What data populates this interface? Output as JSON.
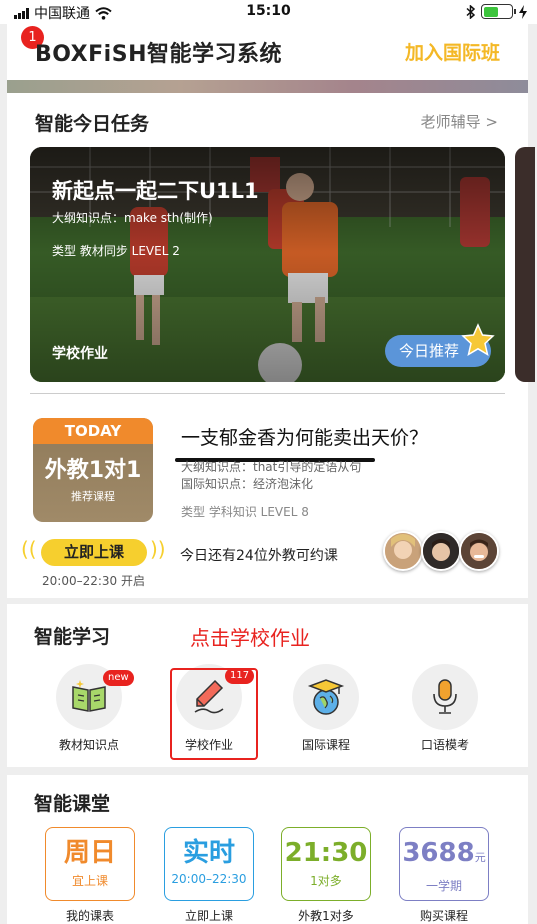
{
  "status_bar": {
    "carrier": "中国联通",
    "time": "15:10"
  },
  "header": {
    "notification_count": "1",
    "title": "BOXFiSH智能学习系统",
    "join_label": "加入国际班"
  },
  "today_task": {
    "title": "智能今日任务",
    "teacher_link": "老师辅导 >",
    "card": {
      "title": "新起点一起二下U1L1",
      "syllabus_point": "大纲知识点：make sth(制作)",
      "type_level": "类型  教材同步   LEVEL 2",
      "tag": "学校作业",
      "recommend": "今日推荐"
    },
    "lesson": {
      "today_label": "TODAY",
      "box_main": "外教1对1",
      "box_sub": "推荐课程",
      "title": "一支郁金香为何能卖出天价？",
      "syllabus_point": "大纲知识点：that引导的定语从句",
      "intl_point": "国际知识点：经济泡沫化",
      "type_level": "类型  学科知识    LEVEL 8",
      "start_label": "立即上课",
      "time_note": "20:00–22:30 开启",
      "teacher_note": "今日还有24位外教可约课"
    }
  },
  "smart_learning": {
    "title": "智能学习",
    "hint": "点击学校作业",
    "items": [
      {
        "label": "教材知识点",
        "icon": "book-icon",
        "badge": "new"
      },
      {
        "label": "学校作业",
        "icon": "pencil-icon",
        "badge": "117"
      },
      {
        "label": "国际课程",
        "icon": "globe-cap-icon"
      },
      {
        "label": "口语模考",
        "icon": "microphone-icon"
      }
    ]
  },
  "smart_classroom": {
    "title": "智能课堂",
    "tiles": [
      {
        "big": "周日",
        "small": "宜上课",
        "label": "我的课表",
        "color": "#f08a2c"
      },
      {
        "big": "实时",
        "small": "20:00–22:30",
        "label": "立即上课",
        "color": "#2a9ee0"
      },
      {
        "big": "21:30",
        "small": "1对多",
        "label": "外教1对多",
        "color": "#7cae2a"
      },
      {
        "big": "3688",
        "unit": "元",
        "small": "一学期",
        "label": "购买课程",
        "color": "#7d7fc4"
      }
    ]
  }
}
